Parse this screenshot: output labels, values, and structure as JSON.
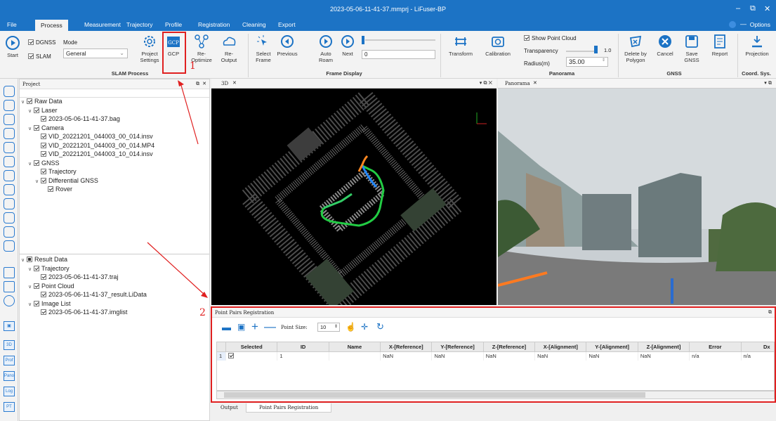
{
  "window": {
    "title": "2023-05-06-11-41-37.mmprj - LiFuser-BP"
  },
  "menu": {
    "items": [
      "File",
      "Process",
      "Measurement",
      "Trajectory",
      "Profile",
      "Registration",
      "Cleaning",
      "Export"
    ],
    "active": "Process",
    "options": "Options"
  },
  "ribbon": {
    "start": "Start",
    "dgnss": "DGNSS",
    "slam": "SLAM",
    "mode_label": "Mode",
    "mode_value": "General",
    "project_settings": "Project Settings",
    "gcp": "GCP",
    "reoptimize": "Re- Optimize",
    "reoutput": "Re- Output",
    "select_frame": "Select Frame",
    "previous": "Previous",
    "auto_roam": "Auto Roam",
    "next": "Next",
    "frame_value": "0",
    "transform": "Transform",
    "calibration": "Calibration",
    "show_point_cloud": "Show Point Cloud",
    "transparency": "Transparency",
    "transparency_value": "1.0",
    "radius": "Radius(m)",
    "radius_value": "35.00",
    "delete_by_polygon": "Delete by Polygon",
    "cancel": "Cancel",
    "save_gnss": "Save GNSS",
    "report": "Report",
    "projection": "Projection",
    "groups": {
      "slam": "SLAM Process",
      "frame": "Frame Display",
      "panorama": "Panorama",
      "gnss": "GNSS",
      "coord": "Coord. Sys."
    }
  },
  "project": {
    "title": "Project",
    "raw": [
      {
        "label": "Raw Data",
        "level": 0
      },
      {
        "label": "Laser",
        "level": 1
      },
      {
        "label": "2023-05-06-11-41-37.bag",
        "level": 2
      },
      {
        "label": "Camera",
        "level": 1
      },
      {
        "label": "VID_20221201_044003_00_014.insv",
        "level": 2
      },
      {
        "label": "VID_20221201_044003_00_014.MP4",
        "level": 2
      },
      {
        "label": "VID_20221201_044003_10_014.insv",
        "level": 2
      },
      {
        "label": "GNSS",
        "level": 1
      },
      {
        "label": "Trajectory",
        "level": 2
      },
      {
        "label": "Differential GNSS",
        "level": 2
      },
      {
        "label": "Rover",
        "level": 3
      }
    ],
    "result": [
      {
        "label": "Result Data",
        "level": 0
      },
      {
        "label": "Trajectory",
        "level": 1
      },
      {
        "label": "2023-05-06-11-41-37.traj",
        "level": 2
      },
      {
        "label": "Point Cloud",
        "level": 1
      },
      {
        "label": "2023-05-06-11-41-37_result.LiData",
        "level": 2
      },
      {
        "label": "Image List",
        "level": 1
      },
      {
        "label": "2023-05-06-11-41-37.imglist",
        "level": 2
      }
    ]
  },
  "views": {
    "tab_3d": "3D",
    "tab_panorama": "Panorama"
  },
  "registration": {
    "title": "Point Pairs Registration",
    "point_size_label": "Point Size:",
    "point_size_value": "10",
    "columns": [
      "",
      "Selected",
      "ID",
      "Name",
      "X-[Reference]",
      "Y-[Reference]",
      "Z-[Reference]",
      "X-[Alignment]",
      "Y-[Alignment]",
      "Z-[Alignment]",
      "Error",
      "Dx"
    ],
    "rows": [
      [
        "1",
        "",
        "1",
        "",
        "NaN",
        "NaN",
        "NaN",
        "NaN",
        "NaN",
        "NaN",
        "n/a",
        "n/a"
      ]
    ]
  },
  "bottom_tabs": [
    "Output",
    "Point Pairs Registration"
  ],
  "annotations": {
    "label1": "1",
    "label2": "2"
  },
  "colors": {
    "accent": "#1c73c5",
    "highlight": "#e02020"
  }
}
